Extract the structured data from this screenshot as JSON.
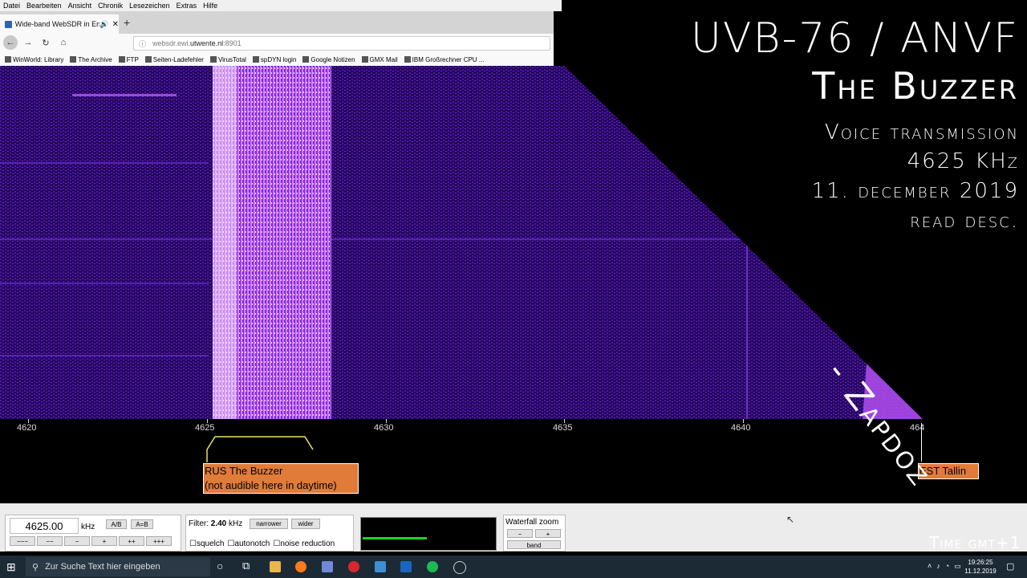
{
  "browser": {
    "menu": [
      "Datei",
      "Bearbeiten",
      "Ansicht",
      "Chronik",
      "Lesezeichen",
      "Extras",
      "Hilfe"
    ],
    "tab_title": "Wide-band WebSDR in Ens",
    "url_prefix": "websdr.ewi.",
    "url_host": "utwente.nl",
    "url_suffix": ":8901",
    "bookmarks": [
      "WinWorld: Library",
      "The Archive",
      "FTP",
      "Seiten-Ladefehler",
      "VirusTotal",
      "spDYN login",
      "Google Notizen",
      "GMX Mail",
      "IBM Großrechner CPU ..."
    ]
  },
  "scale": {
    "ticks": [
      "4620",
      "4625",
      "4630",
      "4635",
      "4640",
      "464"
    ]
  },
  "stations": {
    "buzzer_line1": "RUS The Buzzer",
    "buzzer_line2": "(not audible here in daytime)",
    "est": "EST Tallin"
  },
  "controls": {
    "frequency": "4625.00",
    "unit": "kHz",
    "ab": "A/B",
    "aeqb": "A=B",
    "steps": [
      "−−−",
      "−−",
      "−",
      "+",
      "++",
      "+++"
    ],
    "filter_label": "Filter:",
    "filter_value": "2.40",
    "filter_unit": "kHz",
    "narrower": "narrower",
    "wider": "wider",
    "squelch": "squelch",
    "autonotch": "autonotch",
    "noise": "noise reduction",
    "wf_zoom": "Waterfall zoom",
    "wf_minus": "−",
    "wf_plus": "+",
    "wf_band": "band"
  },
  "overlay": {
    "title1": "UVB-76 / ANVF",
    "title2": "The Buzzer",
    "sub1": "Voice transmission",
    "sub2": "4625 KHz",
    "sub3": "11. december 2019",
    "sub4": "read desc.",
    "signature": "- Zapdoz",
    "time": "Time gmt+1"
  },
  "taskbar": {
    "search_placeholder": "Zur Suche Text hier eingeben",
    "time": "19:26:25",
    "date": "11.12.2019"
  }
}
